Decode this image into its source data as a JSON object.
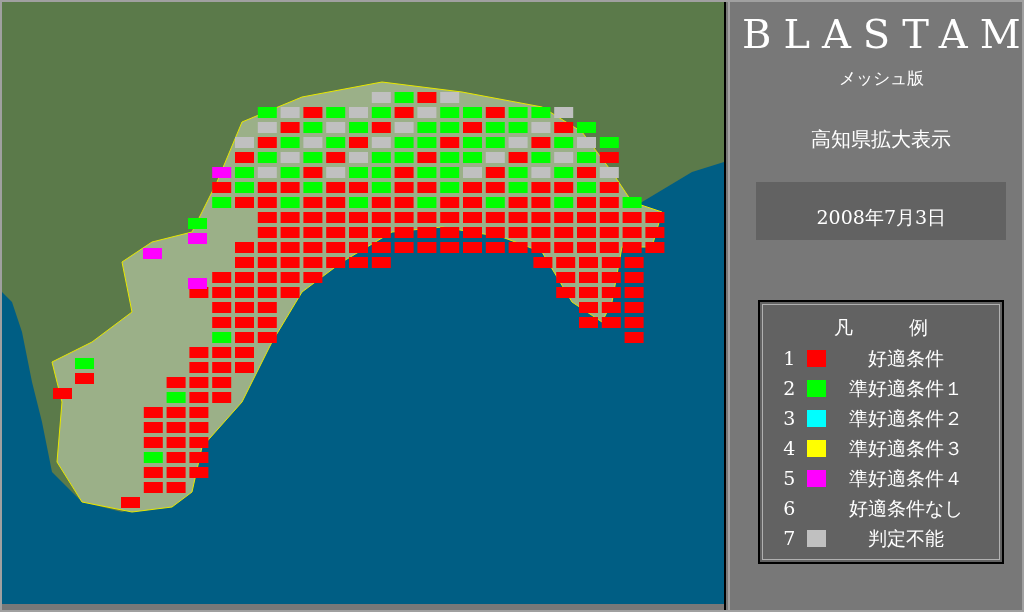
{
  "title": "BLASTAM",
  "subtitle": "メッシュ版",
  "view": "高知県拡大表示",
  "date": "2008年7月3日",
  "legend": {
    "title": [
      "凡",
      "例"
    ],
    "items": [
      {
        "number": "1",
        "label": "好適条件",
        "color": "#ff0000"
      },
      {
        "number": "2",
        "label": "準好適条件１",
        "color": "#00ff00"
      },
      {
        "number": "3",
        "label": "準好適条件２",
        "color": "#00ffff"
      },
      {
        "number": "4",
        "label": "準好適条件３",
        "color": "#ffff00"
      },
      {
        "number": "5",
        "label": "準好適条件４",
        "color": "#ff00ff"
      },
      {
        "number": "6",
        "label": "好適条件なし"
      },
      {
        "number": "7",
        "label": "判定不能",
        "color": "#c0c0c0"
      }
    ]
  }
}
